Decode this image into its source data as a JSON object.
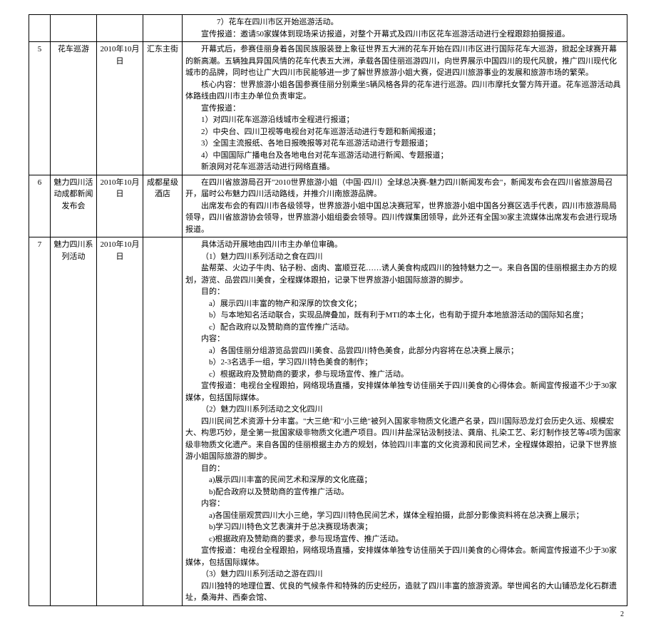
{
  "rows": [
    {
      "num": "",
      "name": "",
      "date": "",
      "place": "",
      "content": {
        "lines": [
          {
            "cls": "indent4",
            "text": "7）花车在四川市区开始巡游活动。"
          },
          {
            "cls": "indent",
            "text": "宣传报道：邀请50家媒体到现场采访报道，对整个开幕式及四川市区花车巡游活动进行全程跟踪拍摄报道。"
          }
        ]
      }
    },
    {
      "num": "5",
      "name": "花车巡游",
      "date": "2010年10月 日",
      "place": "汇东主街",
      "content": {
        "lines": [
          {
            "cls": "indent",
            "text": "开幕式后，参赛佳丽身着各国民族服装登上象征世界五大洲的花车开始在四川市区进行国际花车大巡游，掀起全球赛开幕的新高潮。五辆独具异国风情的花车代表五大洲，承载各国佳丽巡游四川，向世界展示中国四川的现代风貌，推广四川现代化城市的品牌，同时也让广大四川市民能够进一步了解世界旅游小姐大赛，促进四川旅游事业的发展和旅游市场的繁荣。"
          },
          {
            "cls": "indent",
            "text": "核心内容：世界旅游小姐各国参赛佳丽分别乘坐5辆风格各异的花车进行巡游。四川市摩托女警方阵开道。花车巡游活动具体路线由四川市主办单位负责审定。"
          },
          {
            "cls": "indent",
            "text": "宣传报道："
          },
          {
            "cls": "indent2",
            "text": "1）对四川花车巡游沿线城市全程进行报道；"
          },
          {
            "cls": "indent2",
            "text": "2）中央台、四川卫视等电视台对花车巡游活动进行专题和新闻报道；"
          },
          {
            "cls": "indent2",
            "text": "3）全国主流报纸、各地日报晚报等对花车巡游活动进行专题报道；"
          },
          {
            "cls": "indent2",
            "text": "4）中国国际广播电台及各地电台对花车巡游活动进行新闻、专题报道；"
          },
          {
            "cls": "indent",
            "text": "新浪网对花车巡游活动进行网络直播。"
          }
        ]
      }
    },
    {
      "num": "6",
      "name": "魅力四川活动成都新闻发布会",
      "date": "2010年10月 日",
      "place": "成都星级酒店",
      "content": {
        "lines": [
          {
            "cls": "indent",
            "text": "在四川省旅游局召开\"2010世界旅游小姐（中国·四川）全球总决赛-魅力四川新闻发布会\"，新闻发布会在四川省旅游局召开，届时公布魅力四川活动路线，并推介川南旅游品牌。"
          },
          {
            "cls": "indent",
            "text": "出席发布会的有四川市各级领导，世界旅游小姐中国总决赛冠军，世界旅游小姐中国各分赛区选手代表，四川市旅游局局领导，四川省旅游协会领导，世界旅游小姐组委会领导。四川传媒集团领导，此外还有全国30家主流媒体出席发布会进行现场报道。"
          }
        ]
      }
    },
    {
      "num": "7",
      "name": "魅力四川系列活动",
      "date": "2010年10月 日",
      "place": "",
      "content": {
        "lines": [
          {
            "cls": "indent",
            "text": "具体活动开展地由四川市主办单位审确。"
          },
          {
            "cls": "indent",
            "text": "（1）魅力四川系列活动之食在四川"
          },
          {
            "cls": "indent",
            "text": "盐帮菜、火边子牛肉、钻子粉、卤肉、富顺豆花……诱人美食构成四川的独特魅力之一。来自各国的佳丽根据主办方的规划，游览、品尝四川美食，全程媒体跟拍，记录下世界旅游小姐国际旅游的脚步。"
          },
          {
            "cls": "indent",
            "text": "目的："
          },
          {
            "cls": "indent3",
            "text": "a）展示四川丰富的物产和深厚的饮食文化；"
          },
          {
            "cls": "indent3",
            "text": "b）与本地知名活动联合，实现品牌叠加，既有利于MTI的本土化，也有助于提升本地旅游活动的国际知名度；"
          },
          {
            "cls": "indent3",
            "text": "c）配合政府以及赞助商的宣传推广活动。"
          },
          {
            "cls": "indent",
            "text": "内容："
          },
          {
            "cls": "indent3",
            "text": "a）各国佳丽分组游览品尝四川美食、品尝四川特色美食，此部分内容将在总决赛上展示；"
          },
          {
            "cls": "indent3",
            "text": "b）2-3名选手一组，学习四川特色美食的制作；"
          },
          {
            "cls": "indent3",
            "text": "c）根据政府及赞助商的要求，参与现场宣传、推广活动。"
          },
          {
            "cls": "indent",
            "text": "宣传报道：电视台全程跟拍，网络现场直播，安排媒体单独专访佳丽关于四川美食的心得体会。新闻宣传报道不少于30家媒体，包括国际媒体。"
          },
          {
            "cls": "indent",
            "text": "（2）魅力四川系列活动之文化四川"
          },
          {
            "cls": "indent",
            "text": "四川民间艺术资源十分丰富。\"大三绝\"和\"小三绝\"被列入国家非物质文化遗产名录，四川国际恐龙灯会历史久远、规模宏大、构思巧妙，是全第一批国家级非物质文化遗产项目。四川井盐深钻汲制技法、龚扇、扎染工艺、彩灯制作技艺等4项为国家级非物质文化遗产。来自各国的佳丽根据主办方的规划，体验四川丰富的文化资源和民间艺术，全程媒体跟拍，记录下世界旅游小姐国际旅游的脚步。"
          },
          {
            "cls": "indent",
            "text": "目的："
          },
          {
            "cls": "indent3",
            "text": "a)展示四川丰富的民间艺术和深厚的文化底蕴；"
          },
          {
            "cls": "indent3",
            "text": "b)配合政府以及赞助商的宣传推广活动。"
          },
          {
            "cls": "indent",
            "text": "内容："
          },
          {
            "cls": "indent3",
            "text": "a)各国佳丽观赏四川大小三绝，学习四川特色民间艺术，媒体全程拍摄，此部分影像资料将在总决赛上展示；"
          },
          {
            "cls": "indent3",
            "text": "b)学习四川特色文艺表演并于总决赛现场表演；"
          },
          {
            "cls": "indent3",
            "text": "c)根据政府及赞助商的要求，参与现场宣传、推广活动。"
          },
          {
            "cls": "indent",
            "text": "宣传报道：电视台全程跟拍，网络现场直播，安排媒体单独专访佳丽关于四川美食的心得体会。新闻宣传报道不少于30家媒体，包括国际媒体。"
          },
          {
            "cls": "indent",
            "text": "（3）魅力四川系列活动之游在四川"
          },
          {
            "cls": "indent",
            "text": "四川独特的地理位置、优良的气候条件和特殊的历史经历，造就了四川丰富的旅游资源。举世闻名的大山铺恐龙化石群遗址，桑海井、西秦会馆、"
          }
        ]
      }
    }
  ],
  "pagenum": "2"
}
